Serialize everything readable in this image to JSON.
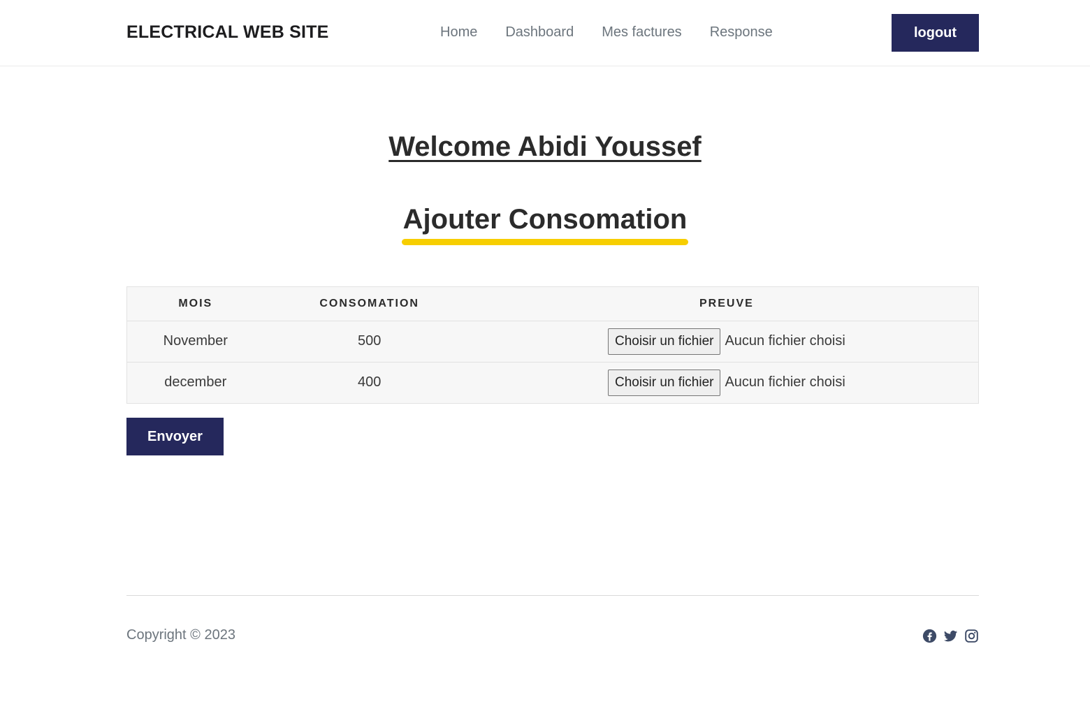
{
  "navbar": {
    "brand": "ELECTRICAL WEB SITE",
    "links": [
      "Home",
      "Dashboard",
      "Mes factures",
      "Response"
    ],
    "logout_label": "logout"
  },
  "main": {
    "welcome": "Welcome Abidi Youssef",
    "section_title": "Ajouter Consomation",
    "table": {
      "headers": [
        "MOIS",
        "CONSOMATION",
        "PREUVE"
      ],
      "rows": [
        {
          "mois": "November",
          "consomation": "500",
          "file_button": "Choisir un fichier",
          "file_status": "Aucun fichier choisi"
        },
        {
          "mois": "december",
          "consomation": "400",
          "file_button": "Choisir un fichier",
          "file_status": "Aucun fichier choisi"
        }
      ]
    },
    "submit_label": "Envoyer"
  },
  "footer": {
    "copyright": "Copyright © 2023",
    "social_icons": [
      "facebook-icon",
      "twitter-icon",
      "instagram-icon"
    ]
  },
  "colors": {
    "primary": "#25285c",
    "accent_underline": "#f7ce00",
    "text_dark": "#2b2b2b",
    "text_muted": "#6c757d"
  }
}
